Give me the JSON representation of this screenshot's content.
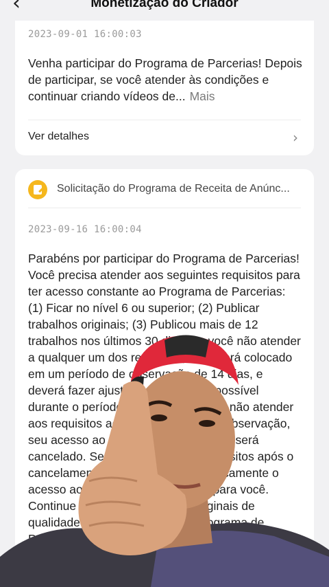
{
  "header": {
    "title": "Monetização do Criador",
    "back_icon": "chevron-left-icon"
  },
  "card1": {
    "timestamp": "2023-09-01 16:00:03",
    "message": "Venha participar do Programa de Parcerias! Depois de participar, se você atender às condições e continuar criando vídeos de...",
    "more_label": "Mais",
    "details_label": "Ver detalhes"
  },
  "card2": {
    "icon": "document-edit-icon",
    "icon_color": "#f5b71d",
    "title": "Solicitação do Programa de Receita de Anúnc...",
    "timestamp": "2023-09-16 16:00:04",
    "message": "Parabéns por participar do Programa de Parcerias! Você precisa atender aos seguintes requisitos para ter acesso constante ao Programa de Parcerias: (1) Ficar no nível 6 ou superior; (2) Publicar trabalhos originais; (3) Publicou mais de 12 trabalhos nos últimos 30 dias. Se você não atender a qualquer um dos requisitos, você será colocado em um período de observação de 14 dias, e deverá fazer ajustes o mais rápido possível durante o período de observação. Se não atender aos requisitos ao final do período de observação, seu acesso ao Programa de Parcerias será cancelado. Se você atender aos requisitos após o cancelamento, reabriremos automaticamente o acesso ao Programa de Parcerias para você. Continue publicando trabalhos originais de qualidade para permanecer no Programa de Parcerias."
  },
  "colors": {
    "background": "#f1f1f3",
    "card": "#ffffff",
    "text": "#222222",
    "muted": "#9a9a9a",
    "accent": "#f5b71d",
    "cap": "#e0283a"
  }
}
